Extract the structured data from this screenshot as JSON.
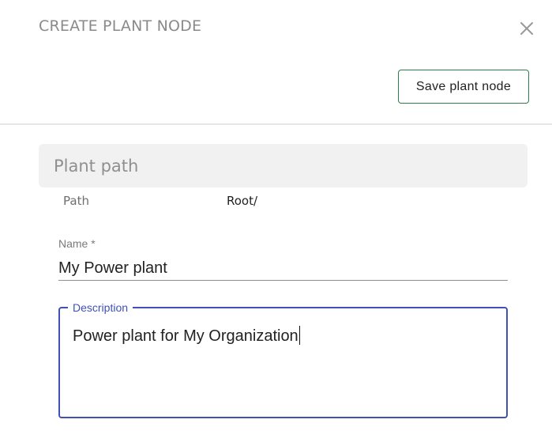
{
  "dialog": {
    "title": "CREATE PLANT NODE",
    "close_icon": "close-icon",
    "save_label": "Save plant node"
  },
  "path_section": {
    "title": "Plant path",
    "path_label": "Path",
    "path_value": "Root/"
  },
  "form": {
    "name": {
      "label": "Name *",
      "value": "My Power plant"
    },
    "description": {
      "label": "Description",
      "value": "Power plant for My Organization"
    }
  },
  "colors": {
    "accent": "#3f51b5",
    "save_border": "#2e7d4a"
  }
}
